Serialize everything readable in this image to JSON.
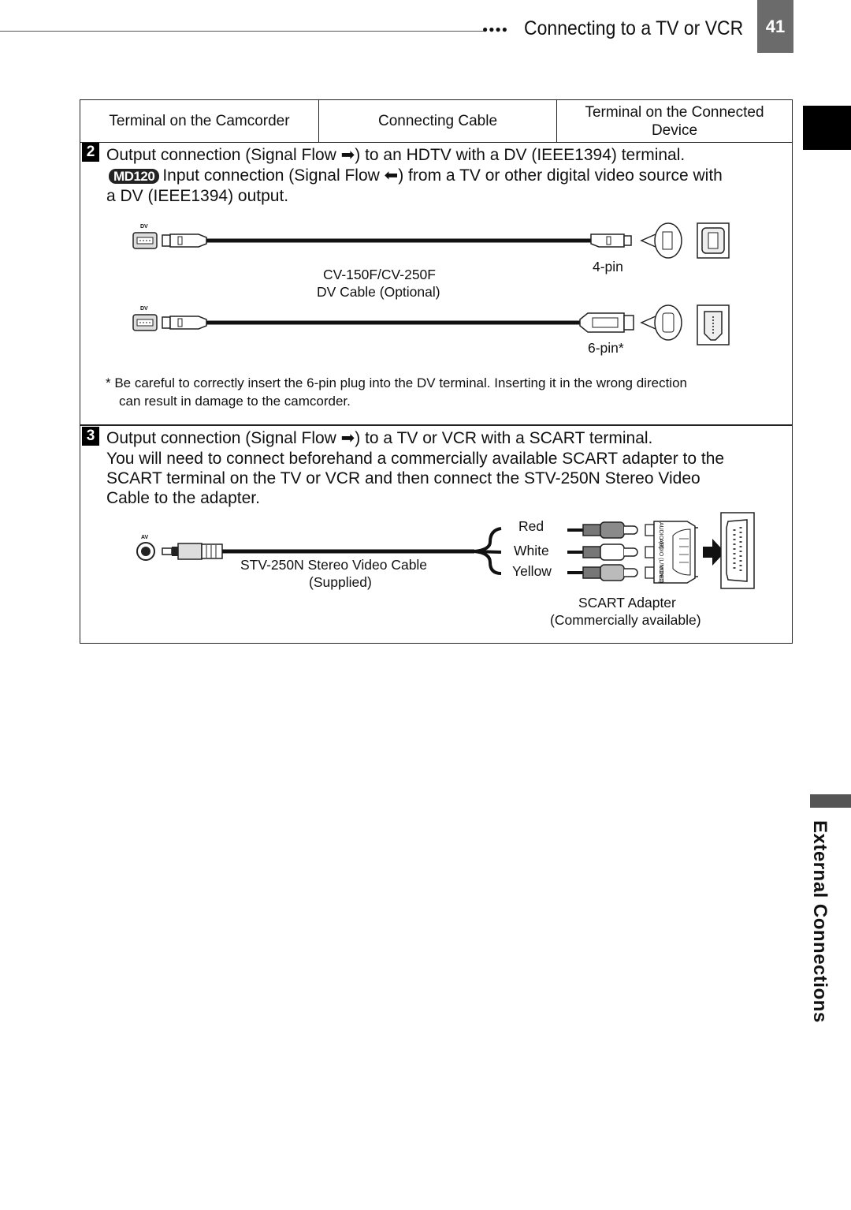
{
  "header": {
    "dots": "●●●●",
    "title": "Connecting to a TV or VCR",
    "page_number": "41"
  },
  "side_tab": {
    "label": "External Connections"
  },
  "table": {
    "columns": [
      "Terminal on the Camcorder",
      "Connecting Cable",
      "Terminal on the Connected Device"
    ],
    "sections": [
      {
        "number": "2",
        "lines": [
          "Output connection (Signal Flow ➡) to an HDTV with a DV (IEEE1394) terminal.",
          "Input connection (Signal Flow ⬅) from a TV or other digital video source with",
          "a DV (IEEE1394) output."
        ],
        "model_badge": "MD120",
        "camcorder_terminal_label": "DV",
        "cable_name": "CV-150F/CV-250F",
        "cable_desc": "DV Cable (Optional)",
        "plug_4pin": "4-pin",
        "plug_6pin": "6-pin*",
        "note_lines": [
          "* Be careful to correctly insert the 6-pin plug into the DV terminal. Inserting it in the wrong direction",
          "can result in damage to the camcorder."
        ]
      },
      {
        "number": "3",
        "lines": [
          "Output connection (Signal Flow ➡) to a TV or VCR with a SCART terminal.",
          "You will need to connect beforehand a commercially available SCART adapter to the",
          "SCART terminal on the TV or VCR and then connect the STV-250N Stereo Video",
          "Cable to the adapter."
        ],
        "camcorder_terminal_label": "AV",
        "cable_name": "STV-250N Stereo Video Cable",
        "cable_desc": "(Supplied)",
        "plug_colors": [
          "Red",
          "White",
          "Yellow"
        ],
        "adapter_jacks": [
          "AUDIO (R)",
          "AUDIO (L/MONO)",
          "VIDEO"
        ],
        "adapter_name": "SCART Adapter",
        "adapter_desc": "(Commercially available)"
      }
    ]
  }
}
